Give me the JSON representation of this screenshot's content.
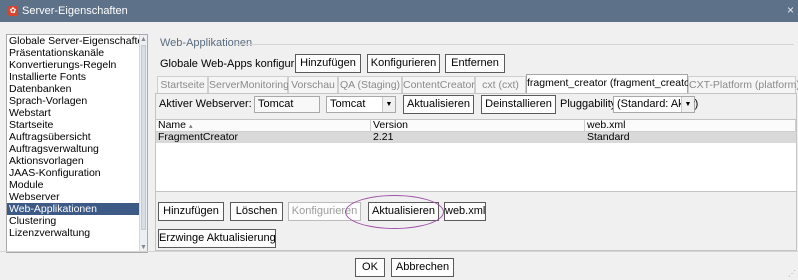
{
  "window": {
    "title": "Server-Eigenschaften",
    "close": "×"
  },
  "sidebar": {
    "items": [
      "Globale Server-Eigenschaften",
      "Präsentationskanäle",
      "Konvertierungs-Regeln",
      "Installierte Fonts",
      "Datenbanken",
      "Sprach-Vorlagen",
      "Webstart",
      "Startseite",
      "Auftragsübersicht",
      "Auftragsverwaltung",
      "Aktionsvorlagen",
      "JAAS-Konfiguration",
      "Module",
      "Webserver",
      "Web-Applikationen",
      "Clustering",
      "Lizenzverwaltung"
    ],
    "selected_index": 14
  },
  "group": {
    "title": "Web-Applikationen",
    "configure_label": "Globale Web-Apps konfigurieren:",
    "add": "Hinzufügen",
    "configure": "Konfigurieren",
    "remove": "Entfernen"
  },
  "tabs": [
    "Startseite",
    "ServerMonitoring",
    "Vorschau",
    "QA (Staging)",
    "ContentCreator",
    "cxt (cxt)",
    "fragment_creator (fragment_creator)",
    "CXT-Platform (platform)"
  ],
  "active_tab": 6,
  "server": {
    "label": "Aktiver Webserver:",
    "value": "Tomcat",
    "combo_value": "Tomcat",
    "update": "Aktualisieren",
    "uninstall": "Deinstallieren",
    "pluggability_label": "Pluggability:",
    "pluggability_value": "(Standard: Aktiv)"
  },
  "table": {
    "columns": [
      "Name",
      "Version",
      "web.xml"
    ],
    "sort_indicator": "▴",
    "rows": [
      {
        "name": "FragmentCreator",
        "version": "2.21",
        "webxml": "Standard"
      }
    ]
  },
  "actions": {
    "add": "Hinzufügen",
    "delete": "Löschen",
    "configure": "Konfigurieren",
    "update": "Aktualisieren",
    "webxml": "web.xml",
    "force_update": "Erzwinge Aktualisierung"
  },
  "dialog": {
    "ok": "OK",
    "cancel": "Abbrechen"
  },
  "colors": {
    "titlebar": "#5d7189",
    "selection": "#3d5a86",
    "highlight": "#a052a8"
  }
}
